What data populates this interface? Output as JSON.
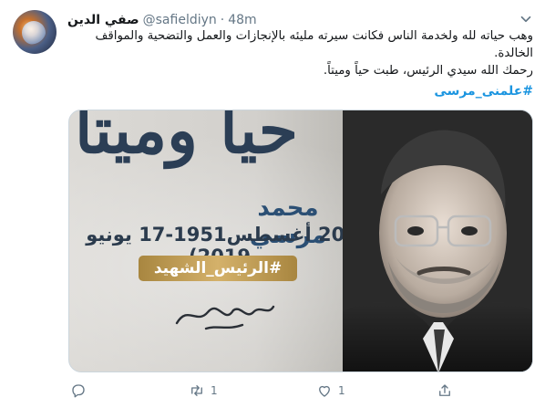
{
  "tweet": {
    "display_name": "صفي الدين",
    "handle": "@safieldiyn",
    "separator": "·",
    "time": "48m",
    "text_line1": "وهب حياته لله ولخدمة الناس فكانت سيرته مليئه بالإنجازات والعمل والتضحية والمواقف الخالدة.",
    "text_line2": "رحمك الله سيدي الرئيس، طبت حياً وميتاً.",
    "hashtag": "#علمنى_مرسى"
  },
  "media": {
    "background_calligraphy": "حياً وميتاً",
    "name": "محمد مرسي",
    "dates": "(20 أغسطس1951-17 يونيو 2019)",
    "badge": "#الرئيس_الشهيد"
  },
  "actions": {
    "reply": {
      "icon": "reply-icon",
      "count": ""
    },
    "retweet": {
      "icon": "retweet-icon",
      "count": "1"
    },
    "like": {
      "icon": "like-icon",
      "count": "1"
    },
    "share": {
      "icon": "share-icon",
      "count": ""
    }
  },
  "colors": {
    "link": "#1b95e0",
    "muted": "#657786",
    "text": "#14171a",
    "border": "#ccd6dd",
    "badge_gold": "#c39f55"
  }
}
